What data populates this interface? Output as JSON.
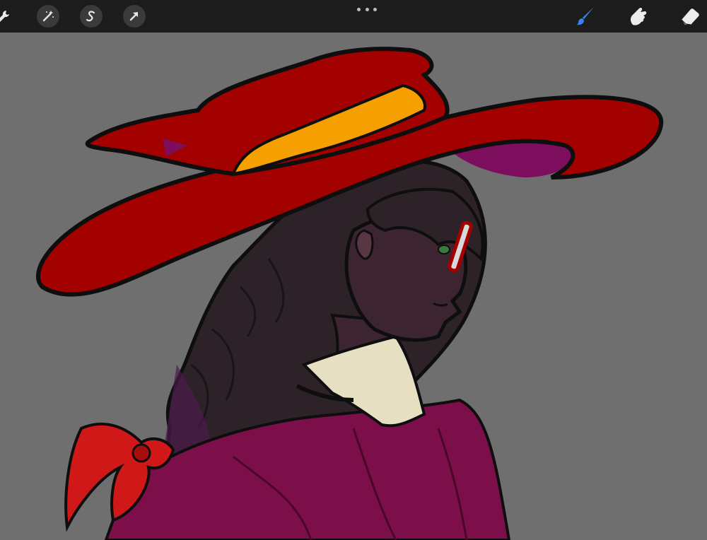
{
  "app": {
    "toolbar": {
      "left_tools": [
        {
          "name": "actions",
          "icon": "wrench-icon"
        },
        {
          "name": "adjustments",
          "icon": "magic-wand-icon"
        },
        {
          "name": "selection",
          "icon": "selection-s-icon"
        },
        {
          "name": "transform",
          "icon": "arrow-cursor-icon"
        }
      ],
      "more_menu_icon": "ellipsis-icon",
      "right_tools": [
        {
          "name": "brush",
          "icon": "brush-icon",
          "active": true,
          "color": "#3b82f6"
        },
        {
          "name": "smudge",
          "icon": "smudge-finger-icon",
          "active": false
        },
        {
          "name": "eraser",
          "icon": "eraser-icon",
          "active": false
        }
      ]
    },
    "canvas": {
      "background_color": "#6f6f6f",
      "artwork": "witch-hat-profile-illustration"
    }
  },
  "colors": {
    "toolbar_bg": "#1c1c1c",
    "hat_red": "#a30000",
    "hat_band": "#f5a000",
    "coat_magenta": "#7c0f4a",
    "hair_dark": "#2c2228",
    "skin": "#3c2530",
    "collar": "#e6dfc2",
    "outline": "#0e0e0e"
  }
}
